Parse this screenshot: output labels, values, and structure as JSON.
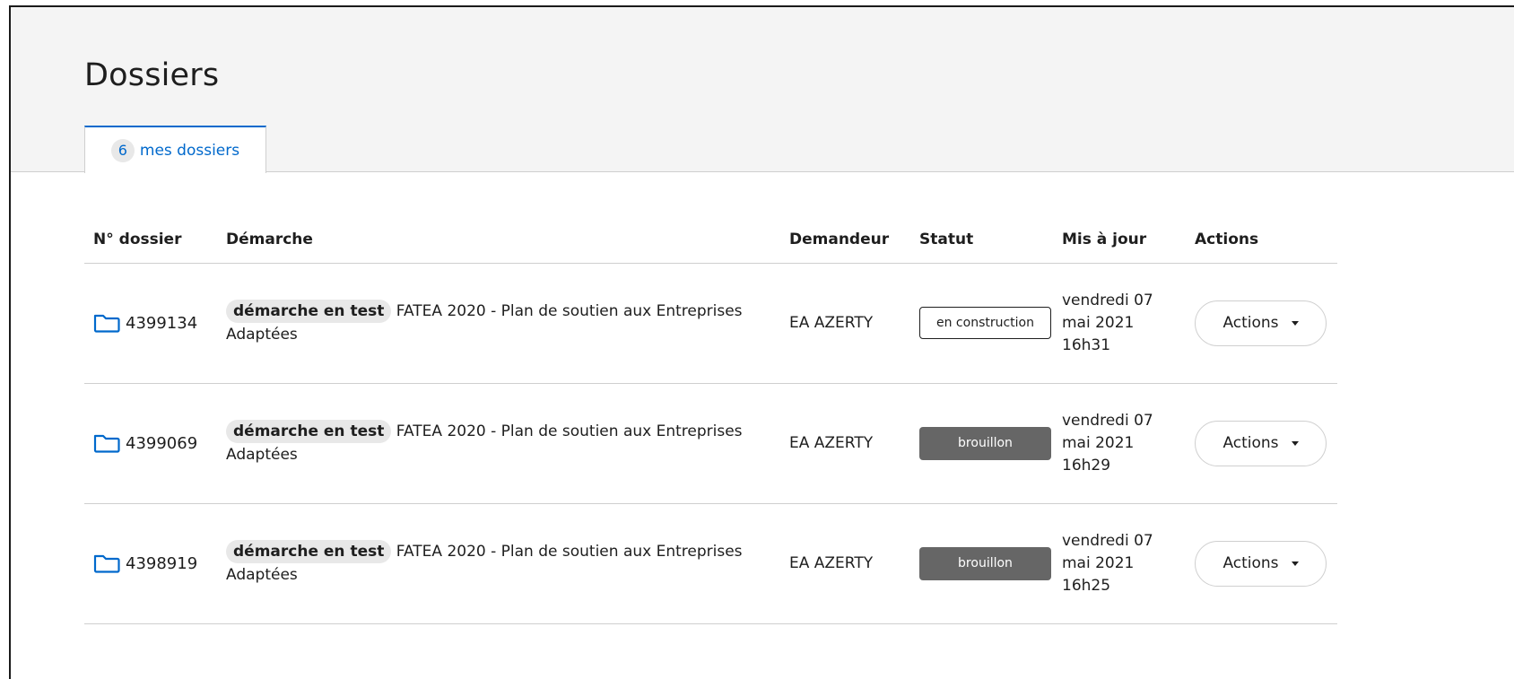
{
  "page": {
    "title": "Dossiers"
  },
  "tabs": [
    {
      "count": "6",
      "label": "mes dossiers",
      "active": true
    }
  ],
  "table": {
    "headers": [
      "N° dossier",
      "Démarche",
      "Demandeur",
      "Statut",
      "Mis à jour",
      "Actions"
    ],
    "rows": [
      {
        "number": "4399134",
        "test_badge": "démarche en test",
        "demarche": "FATEA 2020 - Plan de soutien aux Entreprises Adaptées",
        "demandeur": "EA AZERTY",
        "statut": "en construction",
        "date": "vendredi 07 mai 2021 16h31",
        "actions_label": "Actions"
      },
      {
        "number": "4399069",
        "test_badge": "démarche en test",
        "demarche": "FATEA 2020 - Plan de soutien aux Entreprises Adaptées",
        "demandeur": "EA AZERTY",
        "statut": "brouillon",
        "date": "vendredi 07 mai 2021 16h29",
        "actions_label": "Actions"
      },
      {
        "number": "4398919",
        "test_badge": "démarche en test",
        "demarche": "FATEA 2020 - Plan de soutien aux Entreprises Adaptées",
        "demandeur": "EA AZERTY",
        "statut": "brouillon",
        "date": "vendredi 07 mai 2021 16h25",
        "actions_label": "Actions"
      }
    ]
  },
  "colors": {
    "accent": "#0069cc",
    "status_brouillon": "#666666",
    "header_background": "#f4f4f4",
    "badge_background": "#e8e8e8"
  },
  "icons": {
    "dossier": "folder-icon",
    "actions_dropdown": "caret-down-icon"
  }
}
